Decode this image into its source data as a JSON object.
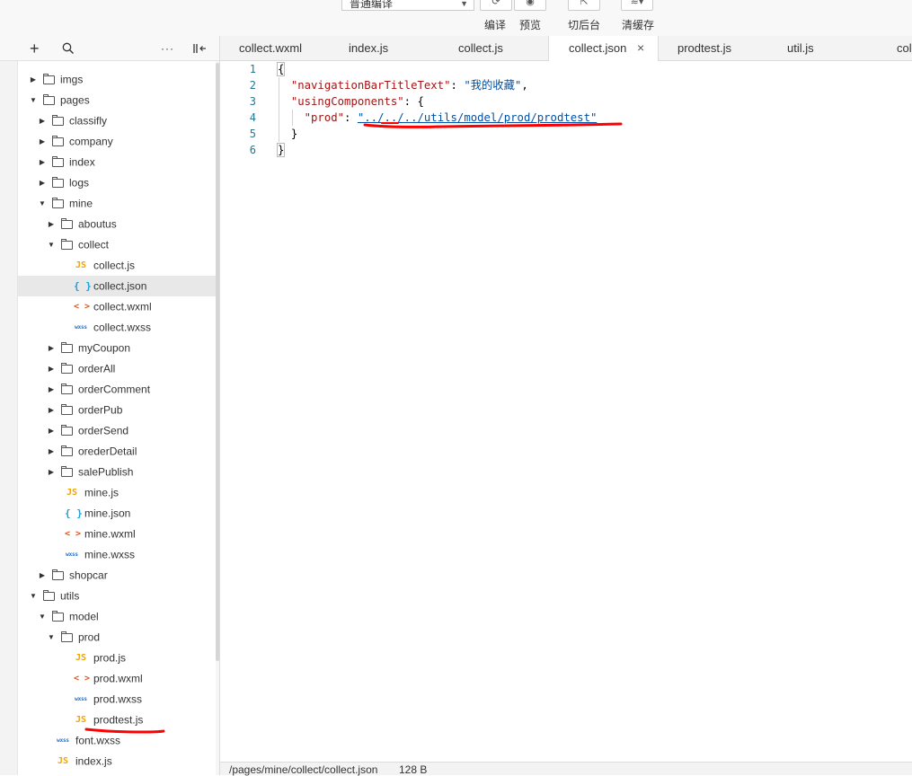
{
  "toolbar": {
    "compile_mode": "普通编译",
    "compile_label": "编译",
    "preview_label": "预览",
    "background_label": "切后台",
    "clear_cache_label": "清缓存"
  },
  "sidebar": {
    "add_icon": "plus-icon",
    "search_icon": "search-icon",
    "more_icon": "more-icon",
    "collapse_icon": "collapse-panel-icon"
  },
  "tree": [
    {
      "name": "imgs",
      "type": "folder",
      "depth": 0,
      "open": false
    },
    {
      "name": "pages",
      "type": "folder",
      "depth": 0,
      "open": true
    },
    {
      "name": "classifly",
      "type": "folder",
      "depth": 1,
      "open": false
    },
    {
      "name": "company",
      "type": "folder",
      "depth": 1,
      "open": false
    },
    {
      "name": "index",
      "type": "folder",
      "depth": 1,
      "open": false
    },
    {
      "name": "logs",
      "type": "folder",
      "depth": 1,
      "open": false
    },
    {
      "name": "mine",
      "type": "folder",
      "depth": 1,
      "open": true
    },
    {
      "name": "aboutus",
      "type": "folder",
      "depth": 2,
      "open": false
    },
    {
      "name": "collect",
      "type": "folder",
      "depth": 2,
      "open": true
    },
    {
      "name": "collect.js",
      "type": "js",
      "depth": 3
    },
    {
      "name": "collect.json",
      "type": "json",
      "depth": 3,
      "selected": true
    },
    {
      "name": "collect.wxml",
      "type": "wxml",
      "depth": 3
    },
    {
      "name": "collect.wxss",
      "type": "wxss",
      "depth": 3
    },
    {
      "name": "myCoupon",
      "type": "folder",
      "depth": 2,
      "open": false
    },
    {
      "name": "orderAll",
      "type": "folder",
      "depth": 2,
      "open": false
    },
    {
      "name": "orderComment",
      "type": "folder",
      "depth": 2,
      "open": false
    },
    {
      "name": "orderPub",
      "type": "folder",
      "depth": 2,
      "open": false
    },
    {
      "name": "orderSend",
      "type": "folder",
      "depth": 2,
      "open": false
    },
    {
      "name": "orederDetail",
      "type": "folder",
      "depth": 2,
      "open": false
    },
    {
      "name": "salePublish",
      "type": "folder",
      "depth": 2,
      "open": false
    },
    {
      "name": "mine.js",
      "type": "js",
      "depth": 2
    },
    {
      "name": "mine.json",
      "type": "json",
      "depth": 2
    },
    {
      "name": "mine.wxml",
      "type": "wxml",
      "depth": 2
    },
    {
      "name": "mine.wxss",
      "type": "wxss",
      "depth": 2
    },
    {
      "name": "shopcar",
      "type": "folder",
      "depth": 1,
      "open": false
    },
    {
      "name": "utils",
      "type": "folder",
      "depth": 0,
      "open": true
    },
    {
      "name": "model",
      "type": "folder",
      "depth": 1,
      "open": true
    },
    {
      "name": "prod",
      "type": "folder",
      "depth": 2,
      "open": true
    },
    {
      "name": "prod.js",
      "type": "js",
      "depth": 3
    },
    {
      "name": "prod.wxml",
      "type": "wxml",
      "depth": 3
    },
    {
      "name": "prod.wxss",
      "type": "wxss",
      "depth": 3
    },
    {
      "name": "prodtest.js",
      "type": "js",
      "depth": 3
    },
    {
      "name": "font.wxss",
      "type": "wxss",
      "depth": 1
    },
    {
      "name": "index.js",
      "type": "js",
      "depth": 1
    }
  ],
  "file_icon_labels": {
    "js": "JS",
    "json": "{ }",
    "wxml": "< >",
    "wxss": "wxss"
  },
  "tabs": [
    {
      "label": "collect.wxml"
    },
    {
      "label": "index.js"
    },
    {
      "label": "collect.js"
    },
    {
      "label": "collect.json",
      "active": true
    },
    {
      "label": "prodtest.js"
    },
    {
      "label": "util.js"
    },
    {
      "label": "colle"
    }
  ],
  "tab_close_glyph": "×",
  "editor": {
    "line_numbers": [
      "1",
      "2",
      "3",
      "4",
      "5",
      "6"
    ],
    "lines": {
      "l1_open": "{",
      "l2_key": "\"navigationBarTitleText\"",
      "l2_colon": ": ",
      "l2_val": "\"我的收藏\"",
      "l2_comma": ",",
      "l3_key": "\"usingComponents\"",
      "l3_rest": ": {",
      "l4_key": "\"prod\"",
      "l4_colon": ": ",
      "l4_val": "\"../../../utils/model/prod/prodtest\"",
      "l5_close": "}",
      "l6_close": "}"
    }
  },
  "status": {
    "path": "/pages/mine/collect/collect.json",
    "size": "128 B"
  },
  "annotation_color": "#ff0000"
}
